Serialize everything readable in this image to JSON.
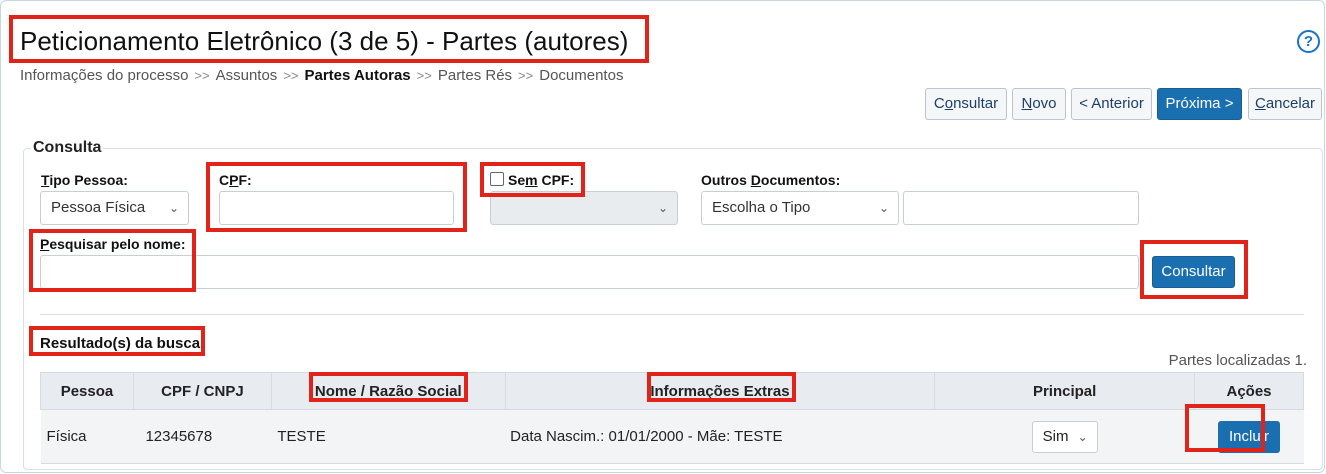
{
  "page_title": "Peticionamento Eletrônico (3 de 5) - Partes (autores)",
  "help_icon": "?",
  "breadcrumb": {
    "separator": ">>",
    "items": [
      "Informações do processo",
      "Assuntos",
      "Partes Autoras",
      "Partes Rés",
      "Documentos"
    ],
    "current_index": 2
  },
  "toolbar": {
    "consultar": {
      "pre": "C",
      "u": "o",
      "post": "nsultar"
    },
    "novo": {
      "pre": "",
      "u": "N",
      "post": "ovo"
    },
    "anterior": "< Anterior",
    "proxima": "Próxima >",
    "cancelar": {
      "pre": "",
      "u": "C",
      "post": "ancelar"
    }
  },
  "consulta": {
    "legend": "Consulta",
    "tipo_pessoa": {
      "label_u": "T",
      "label_rest": "ipo Pessoa:",
      "value": "Pessoa Física"
    },
    "cpf": {
      "label_pre": "C",
      "label_u": "P",
      "label_post": "F:",
      "value": ""
    },
    "sem_cpf": {
      "label_pre": "Se",
      "label_u": "m",
      "label_post": " CPF:",
      "checked": false,
      "select_value": ""
    },
    "outros_documentos": {
      "label_pre": "Outros ",
      "label_u": "D",
      "label_post": "ocumentos:",
      "select_value": "Escolha o Tipo",
      "input_value": ""
    },
    "pesquisar_nome": {
      "label_u": "P",
      "label_rest": "esquisar pelo nome:",
      "value": ""
    },
    "consultar_button": "Consultar"
  },
  "results": {
    "title": "Resultado(s) da busca:",
    "count_text": "Partes localizadas 1.",
    "columns": [
      "Pessoa",
      "CPF / CNPJ",
      "Nome / Razão Social",
      "Informações Extras",
      "Principal",
      "Ações"
    ],
    "rows": [
      {
        "pessoa": "Física",
        "cpf_cnpj": "12345678",
        "nome": "TESTE",
        "info_extra": "Data Nascim.: 01/01/2000 - Mãe: TESTE",
        "principal": "Sim",
        "acao": "Incluir"
      }
    ]
  },
  "colors": {
    "primary": "#1a6fb0",
    "highlight": "#e2231a",
    "header_bg": "#e8ecf1"
  }
}
